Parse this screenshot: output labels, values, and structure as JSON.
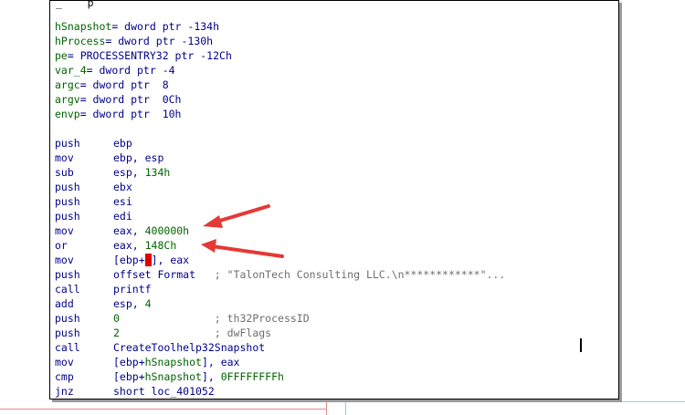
{
  "declarations": [
    {
      "name": "hSnapshot",
      "rest": "= dword ptr -134h"
    },
    {
      "name": "hProcess",
      "rest": "= dword ptr -130h"
    },
    {
      "name": "pe",
      "rest": "= PROCESSENTRY32 ptr -12Ch"
    },
    {
      "name": "var_4",
      "rest": "= dword ptr -4"
    },
    {
      "name": "argc",
      "rest": "= dword ptr  8"
    },
    {
      "name": "argv",
      "rest": "= dword ptr  0Ch"
    },
    {
      "name": "envp",
      "rest": "= dword ptr  10h"
    }
  ],
  "instructions": [
    {
      "mnem": "push",
      "a": "ebp"
    },
    {
      "mnem": "mov",
      "a": "ebp, esp"
    },
    {
      "mnem": "sub",
      "a": "esp, ",
      "n": "134h"
    },
    {
      "mnem": "push",
      "a": "ebx"
    },
    {
      "mnem": "push",
      "a": "esi"
    },
    {
      "mnem": "push",
      "a": "edi"
    },
    {
      "mnem": "mov",
      "a": "eax, ",
      "n": "400000h"
    },
    {
      "mnem": "or",
      "a": "eax, ",
      "n": "148Ch"
    },
    {
      "mnem": "mov",
      "a": "[ebp+",
      "h": "X",
      "b": "], eax"
    },
    {
      "mnem": "push",
      "a": "offset Format",
      "cmt": "   ; \"TalonTech Consulting LLC.\\n************\"..."
    },
    {
      "mnem": "call",
      "a": "printf"
    },
    {
      "mnem": "add",
      "a": "esp, ",
      "n": "4"
    },
    {
      "mnem": "push",
      "n": "0",
      "cmt": "               ; th32ProcessID"
    },
    {
      "mnem": "push",
      "n": "2",
      "cmt": "               ; dwFlags"
    },
    {
      "mnem": "call",
      "a": "CreateToolhelp32Snapshot"
    },
    {
      "mnem": "mov",
      "a": "[ebp+",
      "v": "hSnapshot",
      "b": "], eax"
    },
    {
      "mnem": "cmp",
      "a": "[ebp+",
      "v": "hSnapshot",
      "b": "], ",
      "n": "0FFFFFFFFh"
    },
    {
      "mnem": "jnz",
      "a": "short loc_401052"
    }
  ],
  "colors": {
    "arrow": "#e53935",
    "variables": "#006400",
    "code": "#00008b"
  }
}
